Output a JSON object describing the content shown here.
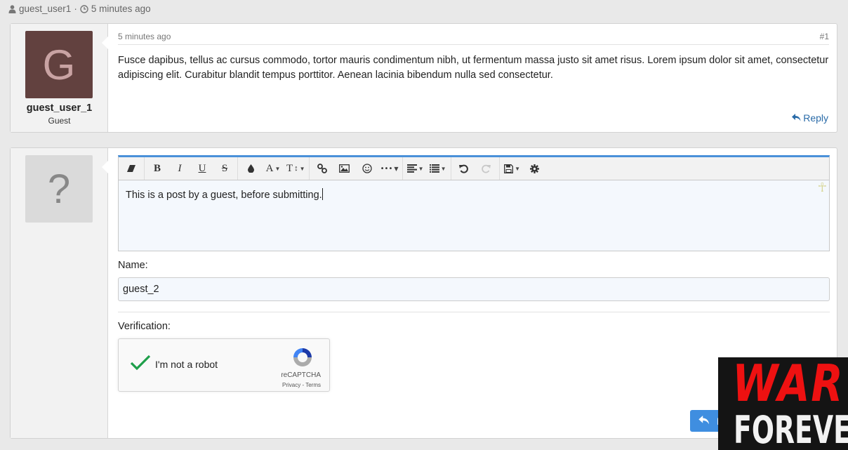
{
  "top_meta": {
    "user_icon": "user-icon",
    "username": "guest_user1",
    "separator": "·",
    "clock_icon": "clock-icon",
    "time": "5 minutes ago"
  },
  "post": {
    "avatar_letter": "G",
    "avatar_color": "#62413f",
    "username": "guest_user_1",
    "role": "Guest",
    "timestamp": "5 minutes ago",
    "post_number": "#1",
    "body": "Fusce dapibus, tellus ac cursus commodo, tortor mauris condimentum nibh, ut fermentum massa justo sit amet risus. Lorem ipsum dolor sit amet, consectetur adipiscing elit. Curabitur blandit tempus porttitor. Aenean lacinia bibendum nulla sed consectetur.",
    "reply_label": "Reply",
    "link_color": "#2a6ba8"
  },
  "reply_form": {
    "avatar_placeholder": "?",
    "toolbar": {
      "accent_color": "#4a90d9",
      "groups": [
        [
          {
            "icon": "eraser-icon",
            "title": "Remove Format"
          }
        ],
        [
          {
            "icon": "bold-icon",
            "glyph": "B"
          },
          {
            "icon": "italic-icon",
            "glyph": "I"
          },
          {
            "icon": "underline-icon",
            "glyph": "U"
          },
          {
            "icon": "strikethrough-icon",
            "glyph": "S"
          }
        ],
        [
          {
            "icon": "color-drop-icon"
          },
          {
            "icon": "font-name-icon",
            "glyph": "A"
          },
          {
            "icon": "font-size-icon",
            "glyph": "T↕"
          }
        ],
        [
          {
            "icon": "link-icon"
          },
          {
            "icon": "image-icon"
          },
          {
            "icon": "emoji-icon"
          },
          {
            "icon": "more-icon",
            "glyph": "•••"
          }
        ],
        [
          {
            "icon": "align-icon"
          },
          {
            "icon": "list-icon"
          }
        ],
        [
          {
            "icon": "undo-icon"
          },
          {
            "icon": "redo-icon",
            "disabled": true
          }
        ],
        [
          {
            "icon": "save-icon"
          },
          {
            "icon": "settings-icon"
          }
        ]
      ]
    },
    "editor_text": "This is a post by a guest, before submitting.",
    "name_label": "Name:",
    "name_value": "guest_2",
    "verification_label": "Verification:",
    "recaptcha": {
      "checked": true,
      "label": "I'm not a robot",
      "brand": "reCAPTCHA",
      "terms": "Privacy - Terms"
    },
    "submit_label": "Reply",
    "submit_color": "#3f8ee0"
  },
  "ad_overlay": {
    "line1": "WAR",
    "line2": "FOREVER"
  }
}
